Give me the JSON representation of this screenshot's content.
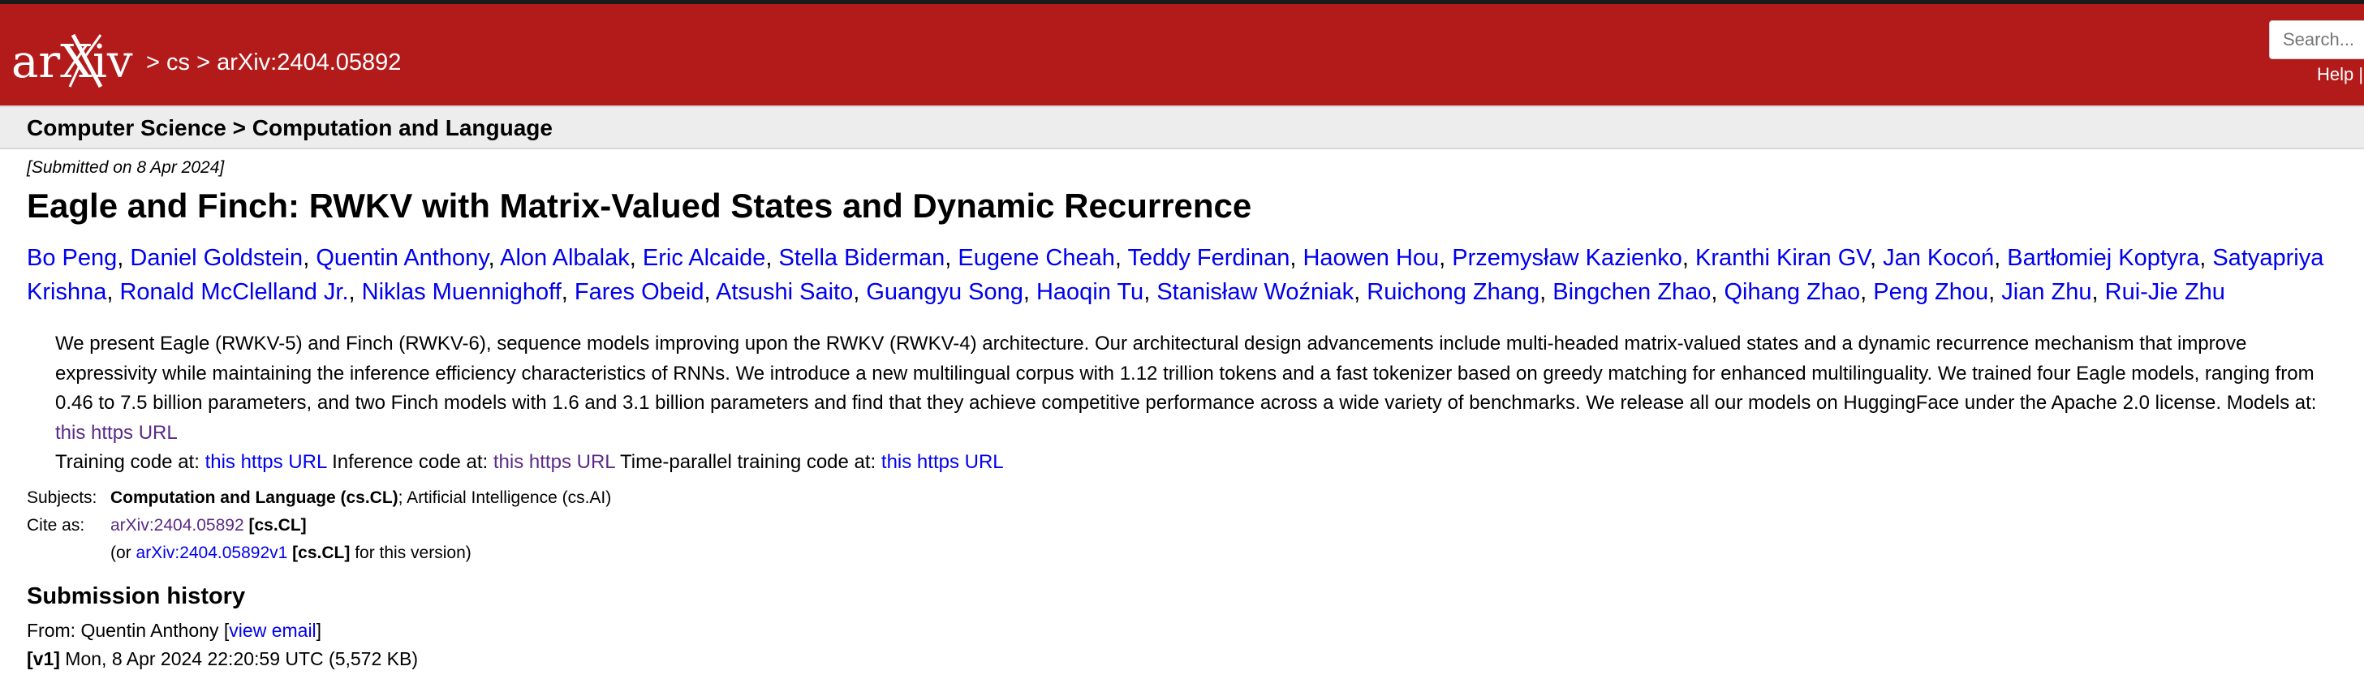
{
  "header": {
    "logo_text": "arXiv",
    "crumbs": [
      ">",
      "cs",
      ">",
      "arXiv:2404.05892"
    ],
    "search_placeholder": "Search...",
    "help_label": "Help |"
  },
  "subheader": {
    "title": "Computer Science > Computation and Language"
  },
  "paper": {
    "dateline": "[Submitted on 8 Apr 2024]",
    "title": "Eagle and Finch: RWKV with Matrix-Valued States and Dynamic Recurrence",
    "authors": [
      "Bo Peng",
      "Daniel Goldstein",
      "Quentin Anthony",
      "Alon Albalak",
      "Eric Alcaide",
      "Stella Biderman",
      "Eugene Cheah",
      "Teddy Ferdinan",
      "Haowen Hou",
      "Przemysław Kazienko",
      "Kranthi Kiran GV",
      "Jan Kocoń",
      "Bartłomiej Koptyra",
      "Satyapriya Krishna",
      "Ronald McClelland Jr.",
      "Niklas Muennighoff",
      "Fares Obeid",
      "Atsushi Saito",
      "Guangyu Song",
      "Haoqin Tu",
      "Stanisław Woźniak",
      "Ruichong Zhang",
      "Bingchen Zhao",
      "Qihang Zhao",
      "Peng Zhou",
      "Jian Zhu",
      "Rui-Jie Zhu"
    ],
    "abstract": {
      "text": "We present Eagle (RWKV-5) and Finch (RWKV-6), sequence models improving upon the RWKV (RWKV-4) architecture. Our architectural design advancements include multi-headed matrix-valued states and a dynamic recurrence mechanism that improve expressivity while maintaining the inference efficiency characteristics of RNNs. We introduce a new multilingual corpus with 1.12 trillion tokens and a fast tokenizer based on greedy matching for enhanced multilinguality. We trained four Eagle models, ranging from 0.46 to 7.5 billion parameters, and two Finch models with 1.6 and 3.1 billion parameters and find that they achieve competitive performance across a wide variety of benchmarks. We release all our models on HuggingFace under the Apache 2.0 license. Models at:",
      "link1": "this https URL",
      "training_label": "Training code at:",
      "link2": "this https URL",
      "inference_label": "Inference code at:",
      "link3": "this https URL",
      "timeparallel_label": "Time-parallel training code at:",
      "link4": "this https URL"
    }
  },
  "meta": {
    "subjects_label": "Subjects:",
    "subjects_primary": "Computation and Language (cs.CL)",
    "subjects_rest": "; Artificial Intelligence (cs.AI)",
    "cite_label": "Cite as:",
    "cite_id": "arXiv:2404.05892",
    "cite_cat": "[cs.CL]",
    "cite_version_prefix": "(or",
    "cite_version_id": "arXiv:2404.05892v1",
    "cite_version_cat": "[cs.CL]",
    "cite_version_suffix": "for this version)"
  },
  "history": {
    "title": "Submission history",
    "from_prefix": "From: Quentin Anthony [",
    "view_email": "view email",
    "from_suffix": "]",
    "v1_label": "[v1]",
    "v1_info": "Mon, 8 Apr 2024 22:20:59 UTC (5,572 KB)"
  },
  "colors": {
    "header_bg": "#b31b1b",
    "link": "#0000ee",
    "visited_link": "#5b2a86",
    "subheader_bg": "#ededed"
  }
}
